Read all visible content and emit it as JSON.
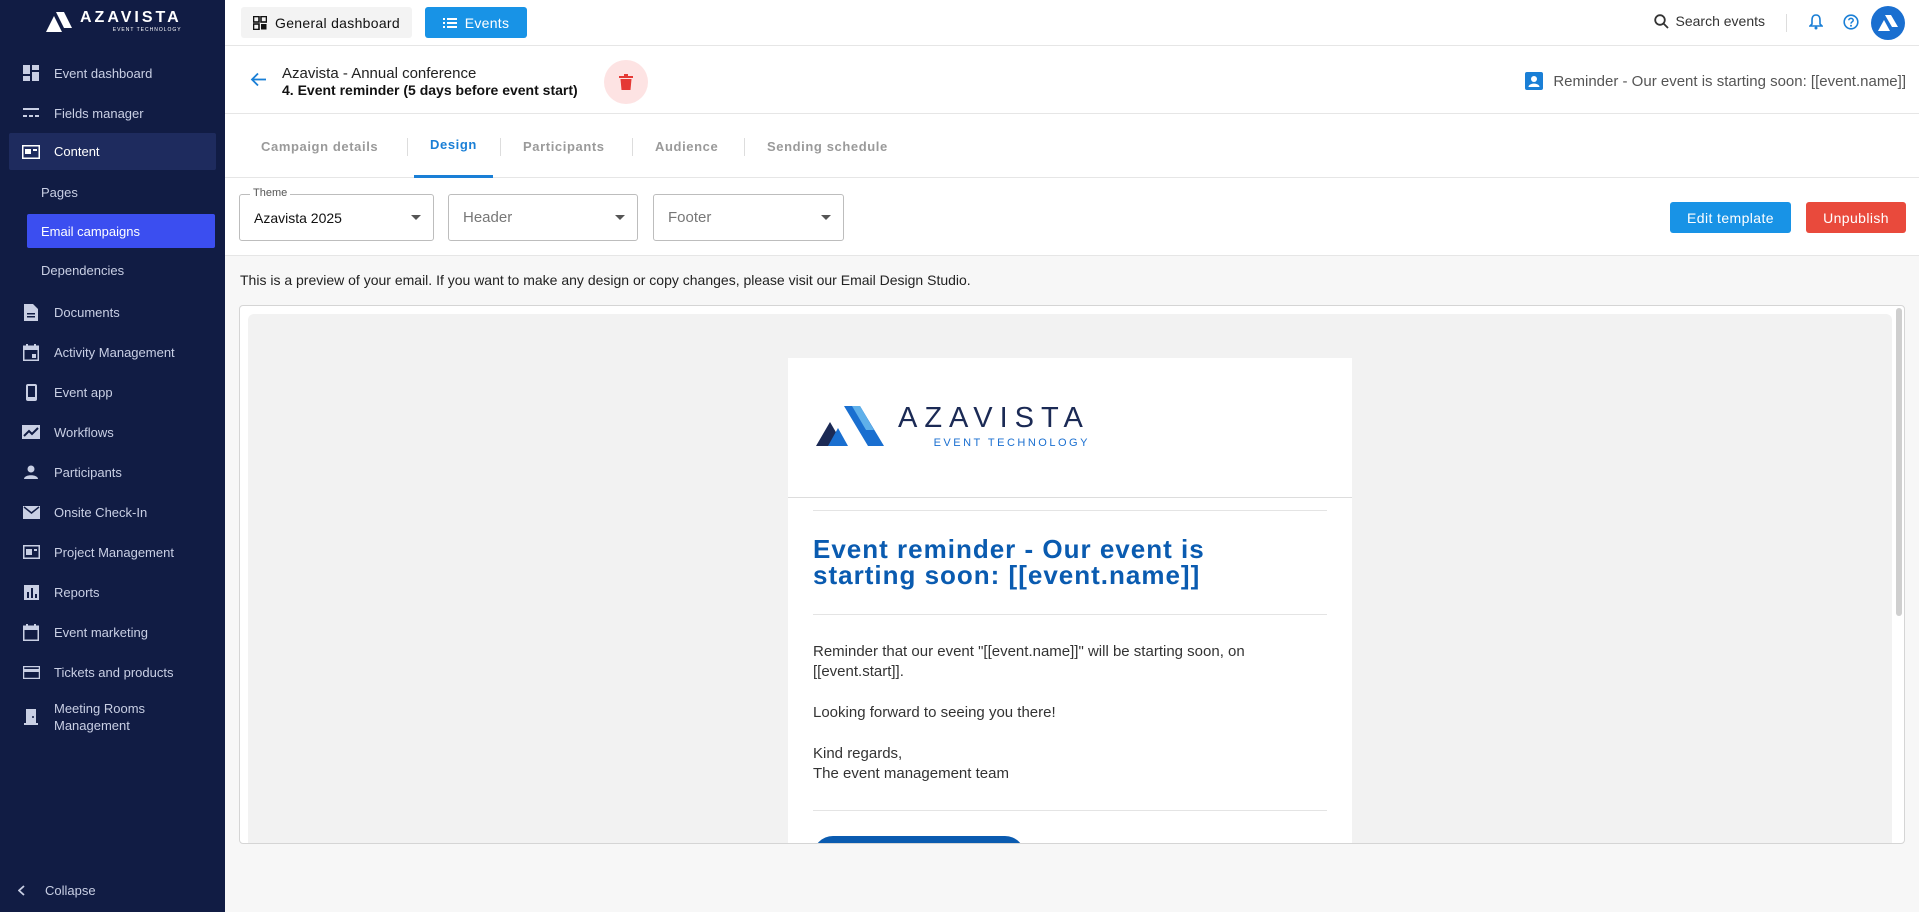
{
  "app": {
    "brand_name": "AZAVISTA",
    "brand_sub": "EVENT TECHNOLOGY",
    "accent_color": "#1893e6",
    "sidebar_color": "#111c44"
  },
  "sidebar": {
    "items": [
      {
        "label": "Event dashboard",
        "icon": "dashboard-icon"
      },
      {
        "label": "Fields manager",
        "icon": "fields-icon"
      },
      {
        "label": "Content",
        "icon": "content-icon"
      },
      {
        "label": "Pages"
      },
      {
        "label": "Email campaigns"
      },
      {
        "label": "Dependencies"
      },
      {
        "label": "Documents",
        "icon": "document-icon"
      },
      {
        "label": "Activity Management",
        "icon": "calendar-icon"
      },
      {
        "label": "Event app",
        "icon": "phone-icon"
      },
      {
        "label": "Workflows",
        "icon": "workflow-icon"
      },
      {
        "label": "Participants",
        "icon": "person-icon"
      },
      {
        "label": "Onsite Check-In",
        "icon": "mail-icon"
      },
      {
        "label": "Project Management",
        "icon": "project-icon"
      },
      {
        "label": "Reports",
        "icon": "chart-icon"
      },
      {
        "label": "Event marketing",
        "icon": "calendar-icon"
      },
      {
        "label": "Tickets and products",
        "icon": "card-icon"
      },
      {
        "label": "Meeting Rooms Management",
        "icon": "door-icon"
      }
    ],
    "collapse_label": "Collapse"
  },
  "topbar": {
    "general_dashboard": "General dashboard",
    "events": "Events",
    "search": "Search events"
  },
  "header": {
    "event_name": "Azavista - Annual conference",
    "campaign_name": "4. Event reminder (5 days before event start)",
    "subject": "Reminder - Our event is starting soon: [[event.name]]"
  },
  "tabs": [
    "Campaign details",
    "Design",
    "Participants",
    "Audience",
    "Sending schedule"
  ],
  "toolbar": {
    "theme_legend": "Theme",
    "theme_value": "Azavista 2025",
    "header_placeholder": "Header",
    "footer_placeholder": "Footer",
    "edit_template": "Edit template",
    "unpublish": "Unpublish"
  },
  "note": "This is a preview of your email. If you want to make any design or copy changes, please visit our Email Design Studio.",
  "email": {
    "logo_name": "AZAVISTA",
    "logo_sub": "EVENT TECHNOLOGY",
    "heading": "Event reminder - Our event is starting soon: [[event.name]]",
    "para1": "Reminder that our event \"[[event.name]]\" will be starting soon, on [[event.start]].",
    "para2": "Looking forward to seeing you there!",
    "sign1": "Kind regards,",
    "sign2": "The event management team"
  }
}
